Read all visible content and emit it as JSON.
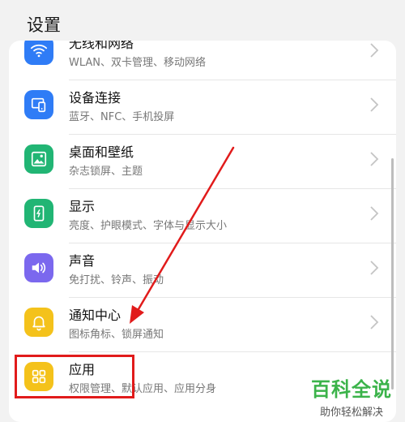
{
  "header": {
    "title": "设置"
  },
  "settings": {
    "items": [
      {
        "title": "无线和网络",
        "subtitle": "WLAN、双卡管理、移动网络",
        "icon": "wifi-icon",
        "color": "#2f7cf6"
      },
      {
        "title": "设备连接",
        "subtitle": "蓝牙、NFC、手机投屏",
        "icon": "device-connect-icon",
        "color": "#2f7cf6"
      },
      {
        "title": "桌面和壁纸",
        "subtitle": "杂志锁屏、主题",
        "icon": "wallpaper-icon",
        "color": "#21b574"
      },
      {
        "title": "显示",
        "subtitle": "亮度、护眼模式、字体与显示大小",
        "icon": "display-icon",
        "color": "#21b574"
      },
      {
        "title": "声音",
        "subtitle": "免打扰、铃声、振动",
        "icon": "sound-icon",
        "color": "#7b68ee"
      },
      {
        "title": "通知中心",
        "subtitle": "图标角标、锁屏通知",
        "icon": "bell-icon",
        "color": "#f4c21b"
      },
      {
        "title": "应用",
        "subtitle": "权限管理、默认应用、应用分身",
        "icon": "apps-icon",
        "color": "#f4c21b"
      }
    ]
  },
  "watermark": {
    "main": "百科全说",
    "sub": "助你轻松解决"
  },
  "colors": {
    "highlight": "#e11b1b",
    "arrow": "#e11b1b",
    "watermark": "#3bb34a"
  }
}
